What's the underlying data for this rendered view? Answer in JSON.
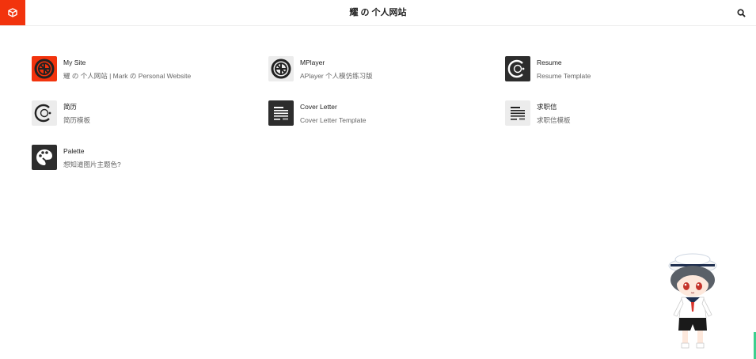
{
  "header": {
    "title": "耀 の 个人网站",
    "logo_icon": "cube-icon",
    "search_icon": "search-icon",
    "brand_color": "#f2330d"
  },
  "cards": [
    {
      "title": "My Site",
      "desc": "耀 の 个人网站 | Mark の Personal Website",
      "icon": "mysite-logo-icon"
    },
    {
      "title": "MPlayer",
      "desc": "APlayer 个人模仿练习版",
      "icon": "mplayer-logo-icon"
    },
    {
      "title": "Resume",
      "desc": "Resume Template",
      "icon": "resume-logo-icon"
    },
    {
      "title": "简历",
      "desc": "简历模板",
      "icon": "resume-cn-logo-icon"
    },
    {
      "title": "Cover Letter",
      "desc": "Cover Letter Template",
      "icon": "cover-letter-icon"
    },
    {
      "title": "求职信",
      "desc": "求职信模板",
      "icon": "cover-letter-cn-icon"
    },
    {
      "title": "Palette",
      "desc": "想知道图片主题色?",
      "icon": "palette-icon"
    }
  ],
  "mascot_icon": "anime-mascot-icon"
}
